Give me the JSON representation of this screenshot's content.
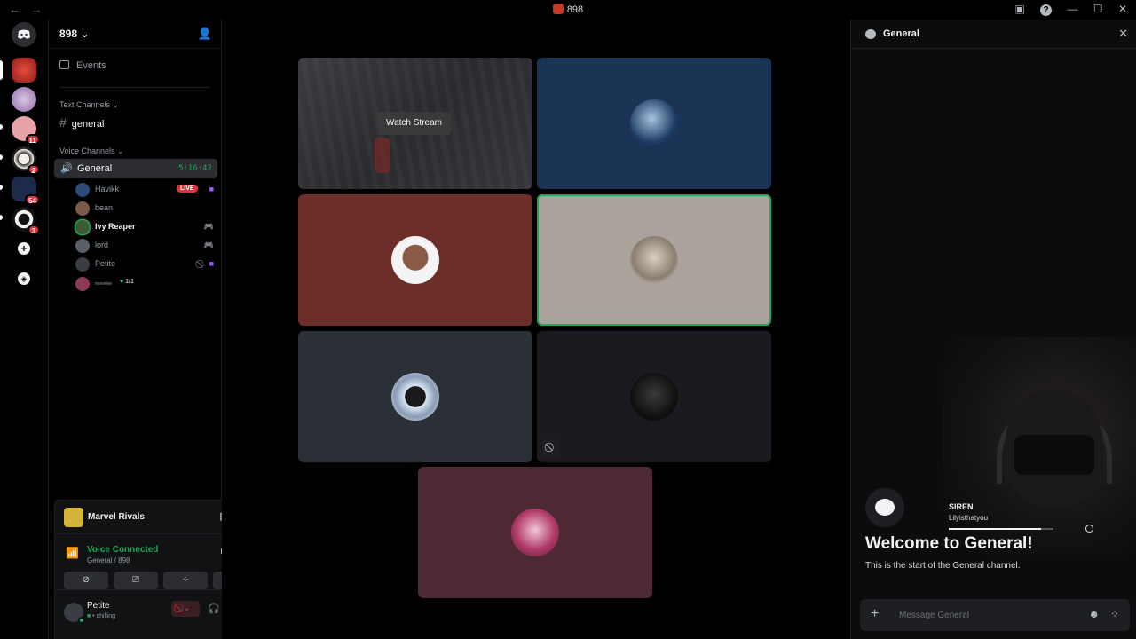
{
  "titlebar": {
    "title": "898",
    "back": "←",
    "forward": "→"
  },
  "rail": {
    "badges": [
      "11",
      "2",
      "54",
      "3"
    ]
  },
  "server": {
    "name": "898 ⌄"
  },
  "nav": {
    "events": "Events"
  },
  "categories": {
    "text": "Text Channels ⌄",
    "voice": "Voice Channels ⌄"
  },
  "text_channels": [
    {
      "name": "general"
    }
  ],
  "voice_channel": {
    "name": "General",
    "elapsed": "5:16:42"
  },
  "members": [
    {
      "name": "Havikk",
      "live": "LIVE"
    },
    {
      "name": "bean"
    },
    {
      "name": "Ivy Reaper"
    },
    {
      "name": "lord"
    },
    {
      "name": "Petite"
    },
    {
      "name": "meeelee",
      "count": "1/1"
    }
  ],
  "activity": {
    "game": "Marvel Rivals"
  },
  "voice": {
    "status": "Voice Connected",
    "location": "General / 898"
  },
  "user": {
    "name": "Petite",
    "status": "chilling"
  },
  "stage": {
    "watch_label": "Watch Stream"
  },
  "chat": {
    "title": "General",
    "cam_name": "SIREN",
    "cam_sub": "Lilyisthatyou",
    "cam_progress": 0.88,
    "welcome": "Welcome to General!",
    "welcome_sub": "This is the start of the General channel.",
    "placeholder": "Message General"
  },
  "colors": {
    "accent_green": "#23a55a",
    "live_red": "#da373c",
    "tile_blue": "#1b3354",
    "tile_red": "#6b2e28",
    "tile_beige": "#a9a39c",
    "tile_slate": "#2b2f38",
    "tile_dark": "#1a1b21",
    "tile_plum": "#4d2a33"
  }
}
